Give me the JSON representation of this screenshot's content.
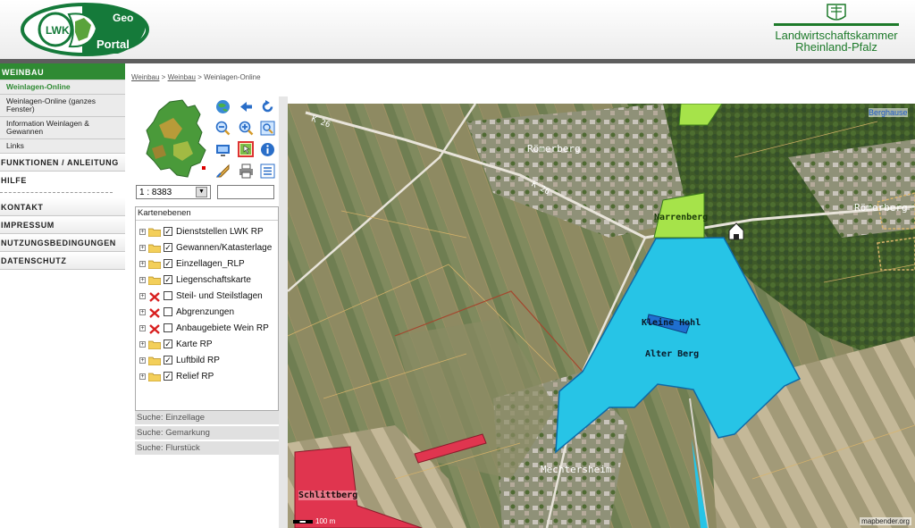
{
  "header": {
    "logo_lwk": "LWK",
    "logo_geo": "Geo",
    "logo_portal": "Portal",
    "brand_line1": "Landwirtschaftskammer",
    "brand_line2": "Rheinland-Pfalz"
  },
  "sidebar": {
    "section_title": "WEINBAU",
    "sub_items": [
      {
        "label": "Weinlagen-Online"
      },
      {
        "label": "Weinlagen-Online (ganzes Fenster)"
      },
      {
        "label": "Information Weinlagen & Gewannen"
      },
      {
        "label": "Links"
      }
    ],
    "main_items": [
      {
        "label": "FUNKTIONEN / ANLEITUNG"
      },
      {
        "label": "HILFE"
      },
      {
        "label": "KONTAKT"
      },
      {
        "label": "IMPRESSUM"
      },
      {
        "label": "NUTZUNGSBEDINGUNGEN"
      },
      {
        "label": "DATENSCHUTZ"
      }
    ]
  },
  "breadcrumb": {
    "item1": "Weinbau",
    "sep": " > ",
    "item2": "Weinbau",
    "item3": "Weinlagen-Online"
  },
  "toolbar": {
    "scale_value": "1 : 8383",
    "scale_input": "",
    "tools": [
      "globe-icon",
      "back-arrow-icon",
      "refresh-icon",
      "zoom-out-icon",
      "zoom-in-icon",
      "zoom-extent-icon",
      "select-icon",
      "pan-active-icon",
      "info-icon",
      "measure-icon",
      "print-icon",
      "legend-list-icon"
    ]
  },
  "layers": {
    "title": "Kartenebenen",
    "items": [
      {
        "label": "Dienststellen LWK RP",
        "checked": true,
        "disabled": false
      },
      {
        "label": "Gewannen/Katasterlage",
        "checked": true,
        "disabled": false
      },
      {
        "label": "Einzellagen_RLP",
        "checked": true,
        "disabled": false
      },
      {
        "label": "Liegenschaftskarte",
        "checked": true,
        "disabled": false
      },
      {
        "label": "Steil- und Steilstlagen",
        "checked": false,
        "disabled": true
      },
      {
        "label": "Abgrenzungen",
        "checked": false,
        "disabled": true
      },
      {
        "label": "Anbaugebiete Wein RP",
        "checked": false,
        "disabled": true
      },
      {
        "label": "Karte RP",
        "checked": true,
        "disabled": false
      },
      {
        "label": "Luftbild RP",
        "checked": true,
        "disabled": false
      },
      {
        "label": "Relief RP",
        "checked": true,
        "disabled": false
      }
    ]
  },
  "search": {
    "einzellage": "Suche: Einzellage",
    "gemarkung": "Suche: Gemarkung",
    "flurstueck": "Suche: Flurstück"
  },
  "map": {
    "labels": {
      "roemerberg_1": "Römerberg",
      "roemerberg_2": "Römerberg",
      "narrenberg": "Narrenberg",
      "kleine_hohl": "Kleine Hohl",
      "alter_berg": "Alter Berg",
      "mechtersheim": "Mechtersheim",
      "schlittberg": "Schlittberg",
      "berghause": "Berghause",
      "road_k26_a": "K 26",
      "road_k26_b": "K 26"
    },
    "scale_text": "100 m",
    "attribution": "mapbender.org",
    "colors": {
      "vineyard_cyan": "#27c4e6",
      "vineyard_green": "#a6e34a",
      "vineyard_red": "#e0354f",
      "accent_green": "#2f8a33"
    }
  }
}
